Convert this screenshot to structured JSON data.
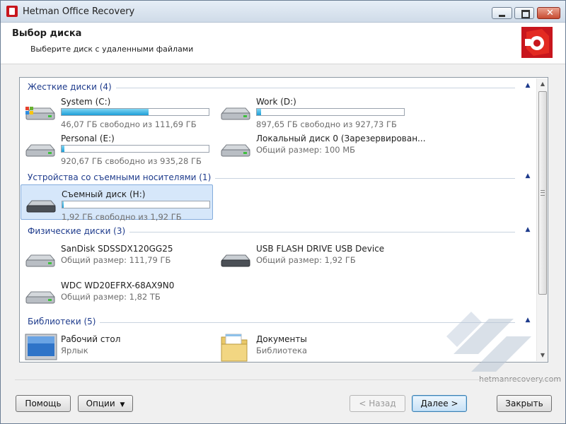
{
  "window": {
    "title": "Hetman Office Recovery"
  },
  "header": {
    "title": "Выбор диска",
    "subtitle": "Выберите диск с удаленными файлами"
  },
  "groups": [
    {
      "label": "Жесткие диски (4)",
      "items": [
        {
          "name": "System (C:)",
          "info": "46,07 ГБ свободно из 111,69 ГБ",
          "used_percent": 59,
          "icon": "windows-drive-icon"
        },
        {
          "name": "Work (D:)",
          "info": "897,65 ГБ свободно из 927,73 ГБ",
          "used_percent": 3,
          "icon": "hard-drive-icon"
        },
        {
          "name": "Personal (E:)",
          "info": "920,67 ГБ свободно из 935,28 ГБ",
          "used_percent": 2,
          "icon": "hard-drive-icon"
        },
        {
          "name": "Локальный диск 0 (Зарезервирован...",
          "info": "Общий размер: 100 МБ",
          "icon": "hard-drive-icon"
        }
      ]
    },
    {
      "label": "Устройства со съемными носителями (1)",
      "items": [
        {
          "name": "Съемный диск (H:)",
          "info": "1,92 ГБ свободно из 1,92 ГБ",
          "used_percent": 1,
          "icon": "removable-drive-icon",
          "selected": true
        }
      ]
    },
    {
      "label": "Физические диски (3)",
      "items": [
        {
          "name": "SanDisk SDSSDX120GG25",
          "info": "Общий размер: 111,79 ГБ",
          "icon": "hard-drive-icon"
        },
        {
          "name": "USB FLASH DRIVE USB Device",
          "info": "Общий размер: 1,92 ГБ",
          "icon": "usb-drive-icon"
        },
        {
          "name": "WDC WD20EFRX-68AX9N0",
          "info": "Общий размер: 1,82 ТБ",
          "icon": "hard-drive-icon"
        }
      ]
    },
    {
      "label": "Библиотеки (5)",
      "items": [
        {
          "name": "Рабочий стол",
          "info": "Ярлык",
          "icon": "desktop-icon"
        },
        {
          "name": "Документы",
          "info": "Библиотека",
          "icon": "documents-folder-icon"
        }
      ]
    }
  ],
  "watermark": "hetmanrecovery.com",
  "buttons": {
    "help": "Помощь",
    "options": "Опции",
    "options_arrow": "▼",
    "back": "< Назад",
    "next": "Далее >",
    "close": "Закрыть"
  },
  "colors": {
    "accent_blue": "#1d9ed7",
    "group_label": "#1e3b8c",
    "brand_red": "#c8161d",
    "selection": "#d6e7fa"
  }
}
